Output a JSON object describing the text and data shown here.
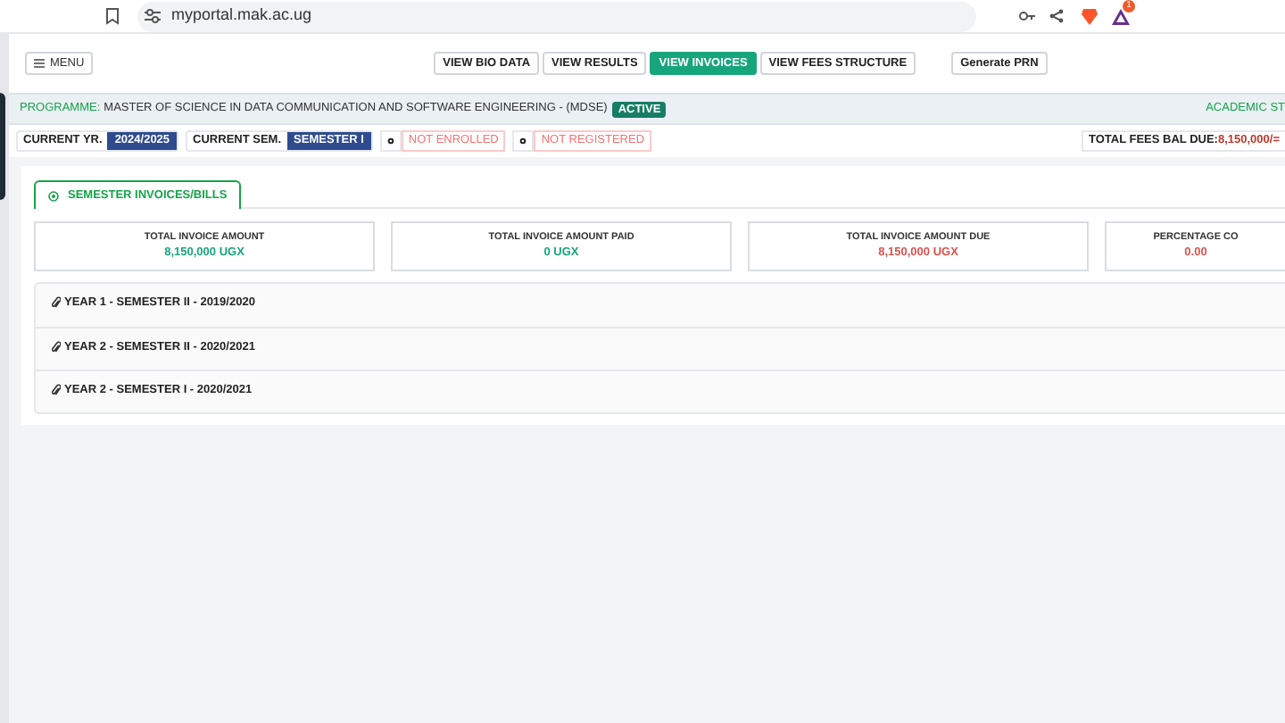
{
  "browser": {
    "url": "myportal.mak.ac.ug",
    "notification_count": "1"
  },
  "nav": {
    "menu_label": "MENU",
    "tabs": [
      {
        "label": "VIEW BIO DATA",
        "selected": false
      },
      {
        "label": "VIEW RESULTS",
        "selected": false
      },
      {
        "label": "VIEW INVOICES",
        "selected": true
      },
      {
        "label": "VIEW FEES STRUCTURE",
        "selected": false
      }
    ],
    "action_button": "Generate PRN"
  },
  "programme_bar": {
    "label": "PROGRAMME:",
    "name": "MASTER OF SCIENCE IN DATA COMMUNICATION AND SOFTWARE ENGINEERING - (MDSE)",
    "status": "ACTIVE",
    "right_text": "ACADEMIC ST"
  },
  "status_row": {
    "current_year_label": "CURRENT YR.",
    "current_year": "2024/2025",
    "current_sem_label": "CURRENT SEM.",
    "current_sem": "SEMESTER I",
    "flags": [
      "NOT ENROLLED",
      "NOT REGISTERED"
    ],
    "fees_label": "TOTAL FEES BAL DUE:",
    "fees_value": "8,150,000/="
  },
  "invoices": {
    "tab": {
      "label": "SEMESTER INVOICES/BILLS",
      "selected": true
    },
    "stats": [
      {
        "label": "TOTAL INVOICE AMOUNT",
        "value": "8,150,000 UGX",
        "color": "#17a57c"
      },
      {
        "label": "TOTAL INVOICE AMOUNT PAID",
        "value": "0 UGX",
        "color": "#17a57c"
      },
      {
        "label": "TOTAL INVOICE AMOUNT DUE",
        "value": "8,150,000 UGX",
        "color": "#d9534f"
      },
      {
        "label": "PERCENTAGE CO",
        "value": "0.00",
        "color": "#d9534f"
      }
    ],
    "semesters": [
      "YEAR 1 - SEMESTER II - 2019/2020",
      "YEAR 2 - SEMESTER II - 2020/2021",
      "YEAR 2 - SEMESTER I - 2020/2021"
    ]
  }
}
